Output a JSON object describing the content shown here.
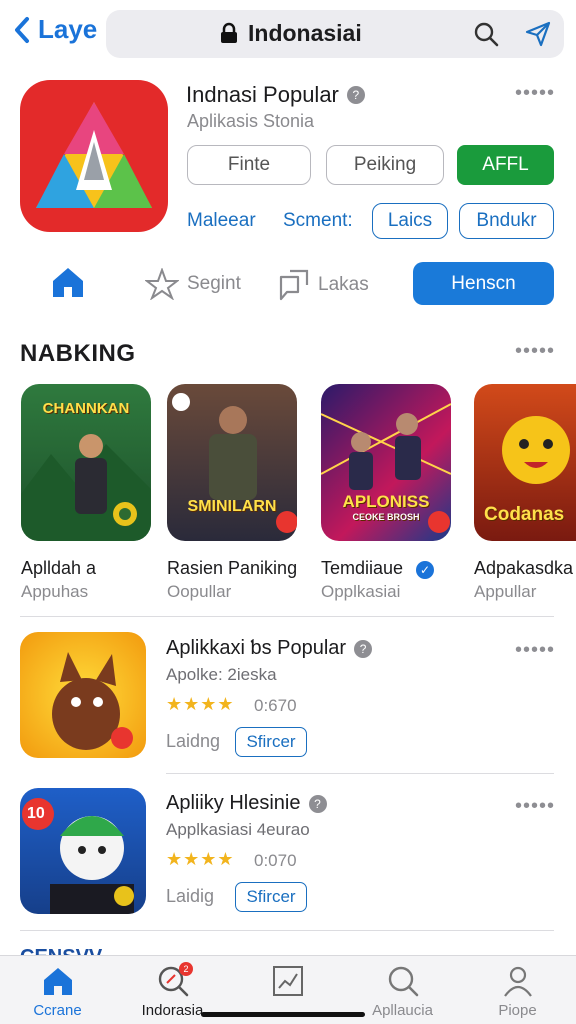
{
  "header": {
    "back_label": "Laye",
    "search_title": "Indonasiai"
  },
  "app": {
    "name": "Indnasi Popular",
    "subtitle": "Aplikasis Stonia",
    "buttons": [
      "Finte",
      "Peiking",
      "AFFL"
    ],
    "links": [
      "Maleear",
      "Scment:"
    ],
    "chips": [
      "Laics",
      "Bndukr"
    ],
    "colors": {
      "accent": "#1a73d9",
      "green": "#1a9b3c",
      "icon_bg": "#e32a2a"
    }
  },
  "navrow": {
    "home_icon": "home-icon",
    "items": [
      {
        "label": "Segint",
        "icon": "compass-icon"
      },
      {
        "label": "Lakas",
        "icon": "chat-icon"
      }
    ],
    "primary_button": "Henscn"
  },
  "ranking": {
    "title": "NABKING",
    "cards": [
      {
        "art": "CHANNKAN",
        "name": "Aplldah a",
        "sub": "Appuhas"
      },
      {
        "art": "SMINILARN",
        "name": "Rasien Paniking",
        "sub": "Oopullar"
      },
      {
        "art": "APLONISS",
        "art_sub": "CEOKE BROSH",
        "name": "Temdiiaue",
        "sub": "Opplkasiai",
        "verified": true
      },
      {
        "art": "Codanas",
        "name": "Adpakasdka",
        "sub": "Appullar"
      }
    ]
  },
  "list": [
    {
      "title": "Aplikkaxi ƅs Popular",
      "sub": "Apolke: 2ieska",
      "stars": "★★★★",
      "count": "0:670",
      "meta": "Laidng",
      "chip": "Sfircer"
    },
    {
      "title": "Apliiky Hlesinie",
      "sub": "Applkasiasi 4eurao",
      "stars": "★★★★",
      "count": "0:070",
      "meta": "Laidig",
      "chip": "Sfircer",
      "badge_num": "10"
    }
  ],
  "peek_text": "CENSVV",
  "tabbar": {
    "tabs": [
      {
        "label": "Ccrane",
        "icon": "home-icon",
        "active": true
      },
      {
        "label": "Indorasia",
        "icon": "search-icon",
        "notif": "2"
      },
      {
        "label": "",
        "icon": "chart-icon"
      },
      {
        "label": "Apllaucia",
        "icon": "search-icon"
      },
      {
        "label": "Piope",
        "icon": "person-icon"
      }
    ]
  }
}
